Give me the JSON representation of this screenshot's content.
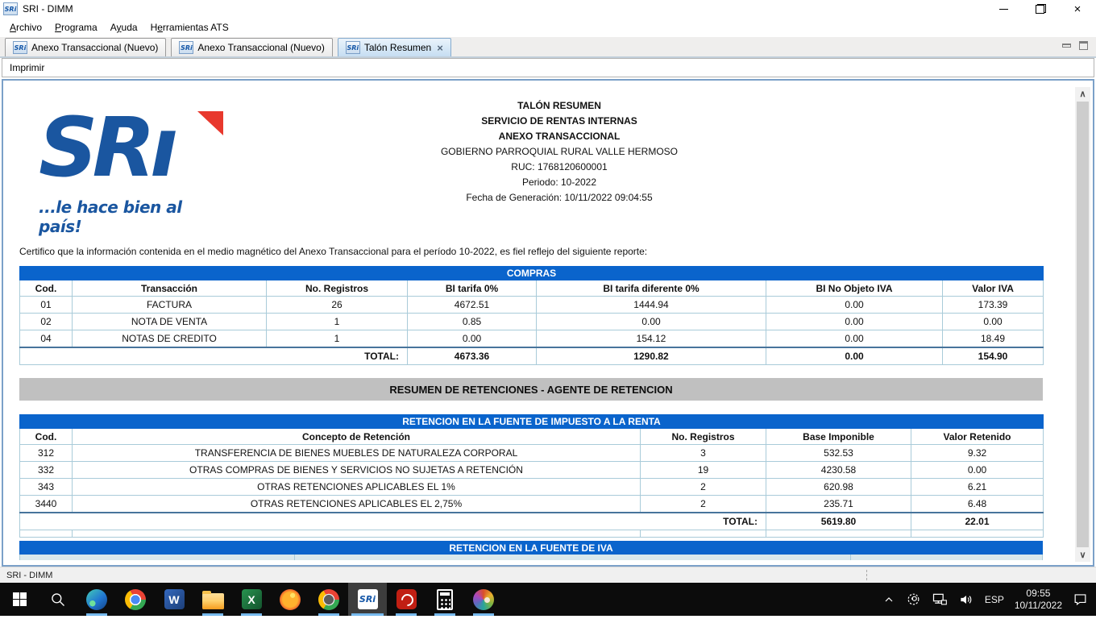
{
  "window": {
    "title": "SRI - DIMM"
  },
  "icons": {
    "close": "×",
    "tab_close": "×",
    "chevron_up": "∧",
    "chevron_down": "∨"
  },
  "menu": {
    "items": [
      {
        "pre": "",
        "key": "A",
        "post": "rchivo"
      },
      {
        "pre": "",
        "key": "P",
        "post": "rograma"
      },
      {
        "pre": "A",
        "key": "y",
        "post": "uda"
      },
      {
        "pre": "H",
        "key": "e",
        "post": "rramientas ATS"
      }
    ]
  },
  "tabs": {
    "items": [
      {
        "label": "Anexo Transaccional (Nuevo)",
        "active": false
      },
      {
        "label": "Anexo Transaccional (Nuevo)",
        "active": false
      },
      {
        "label": "Talón Resumen",
        "active": true
      }
    ]
  },
  "toolbar": {
    "print_label": "Imprimir"
  },
  "logo": {
    "text": "SRi",
    "text_display": "SRı",
    "tagline": "...le hace bien al país!"
  },
  "report": {
    "title_lines": [
      "TALÓN RESUMEN",
      "SERVICIO DE RENTAS INTERNAS",
      "ANEXO TRANSACCIONAL"
    ],
    "info_lines": [
      "GOBIERNO PARROQUIAL RURAL VALLE HERMOSO",
      "RUC: 1768120600001",
      "Periodo: 10-2022",
      "Fecha de Generación: 10/11/2022 09:04:55"
    ],
    "certification": "Certifico que la información contenida en el medio magnético del Anexo Transaccional para el período 10-2022, es fiel reflejo del siguiente reporte:",
    "compras": {
      "title": "COMPRAS",
      "headers": [
        "Cod.",
        "Transacción",
        "No. Registros",
        "BI tarifa 0%",
        "BI tarifa diferente 0%",
        "BI No Objeto IVA",
        "Valor IVA"
      ],
      "rows": [
        [
          "01",
          "FACTURA",
          "26",
          "4672.51",
          "1444.94",
          "0.00",
          "173.39"
        ],
        [
          "02",
          "NOTA DE VENTA",
          "1",
          "0.85",
          "0.00",
          "0.00",
          "0.00"
        ],
        [
          "04",
          "NOTAS DE CREDITO",
          "1",
          "0.00",
          "154.12",
          "0.00",
          "18.49"
        ]
      ],
      "total_label": "TOTAL:",
      "totals": [
        "4673.36",
        "1290.82",
        "0.00",
        "154.90"
      ]
    },
    "retenciones_banner": "RESUMEN DE RETENCIONES - AGENTE DE RETENCION",
    "renta": {
      "title": "RETENCION EN LA FUENTE DE IMPUESTO A LA RENTA",
      "headers": [
        "Cod.",
        "Concepto de Retención",
        "No. Registros",
        "Base Imponible",
        "Valor Retenido"
      ],
      "rows": [
        [
          "312",
          "TRANSFERENCIA DE BIENES MUEBLES DE NATURALEZA CORPORAL",
          "3",
          "532.53",
          "9.32"
        ],
        [
          "332",
          "OTRAS COMPRAS DE BIENES Y SERVICIOS NO SUJETAS A RETENCIÓN",
          "19",
          "4230.58",
          "0.00"
        ],
        [
          "343",
          "OTRAS RETENCIONES APLICABLES EL 1%",
          "2",
          "620.98",
          "6.21"
        ],
        [
          "3440",
          "OTRAS RETENCIONES APLICABLES EL 2,75%",
          "2",
          "235.71",
          "6.48"
        ]
      ],
      "total_label": "TOTAL:",
      "totals": [
        "5619.80",
        "22.01"
      ]
    },
    "iva": {
      "title": "RETENCION EN LA FUENTE DE IVA"
    }
  },
  "status_bar": {
    "text": "SRI - DIMM"
  },
  "taskbar": {
    "apps": [
      {
        "name": "start"
      },
      {
        "name": "search"
      },
      {
        "name": "edge"
      },
      {
        "name": "chrome"
      },
      {
        "name": "word",
        "glyph": "W"
      },
      {
        "name": "file-explorer"
      },
      {
        "name": "excel",
        "glyph": "X"
      },
      {
        "name": "firefox"
      },
      {
        "name": "chrome-profile"
      },
      {
        "name": "sri-dimm",
        "glyph": "SRi"
      },
      {
        "name": "acrobat"
      },
      {
        "name": "calculator"
      },
      {
        "name": "paint"
      }
    ],
    "tray": {
      "language": "ESP",
      "time": "09:55",
      "date": "10/11/2022"
    }
  },
  "colors": {
    "table_header_blue": "#0a64cc",
    "table_subheader": "#d9e8ec",
    "banner_gray": "#c0c0c0",
    "logo_blue": "#1a56a0",
    "logo_red": "#e8382d",
    "taskbar_run_indicator": "#76b9ed"
  }
}
